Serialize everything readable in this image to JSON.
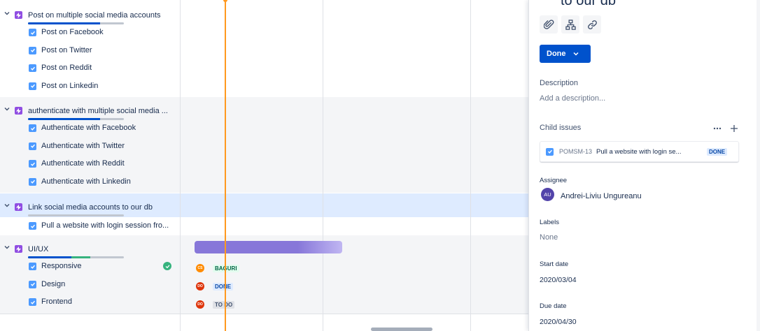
{
  "epics": [
    {
      "title": "Post on multiple social media accounts",
      "progress_done_pct": 75,
      "progress_inprogress_pct": 0,
      "children": [
        "Post on Facebook",
        "Post on Twitter",
        "Post on Reddit",
        "Post on Linkedin"
      ]
    },
    {
      "title": "authenticate with multiple social media ...",
      "progress_done_pct": 75,
      "progress_inprogress_pct": 0,
      "children": [
        "Authenticate with Facebook",
        "Authenticate with Twitter",
        "Authenticate with Reddit",
        "Authenticate with Linkedin"
      ]
    },
    {
      "title": "Link social media accounts to our db",
      "progress_done_pct": 0,
      "progress_inprogress_pct": 0,
      "children": [
        "Pull a website with login session fro..."
      ]
    },
    {
      "title": "UI/UX",
      "progress_done_pct": 45,
      "progress_inprogress_pct": 20,
      "children": [
        "Responsive",
        "Design",
        "Frontend"
      ]
    }
  ],
  "timeline": {
    "statuses": [
      {
        "initials": "CS",
        "label": "BAGURI",
        "avatar_color": "#ff8b00",
        "text_color": "#006644",
        "bg_color": "#e3fcef"
      },
      {
        "initials": "DO",
        "label": "DONE",
        "avatar_color": "#de350b",
        "text_color": "#0747a6",
        "bg_color": "#deebff"
      },
      {
        "initials": "DO",
        "label": "TO DO",
        "avatar_color": "#de350b",
        "text_color": "#42526e",
        "bg_color": "#dfe1e6"
      }
    ]
  },
  "panel": {
    "title": "to our db",
    "status_button": "Done",
    "description_label": "Description",
    "description_placeholder": "Add a description...",
    "child_issues_label": "Child issues",
    "child_issue": {
      "key": "POMSM-13",
      "summary": "Pull a website with login se...",
      "status": "DONE"
    },
    "assignee_label": "Assignee",
    "assignee_initials": "AU",
    "assignee_name": "Andrei-Liviu Ungureanu",
    "labels_label": "Labels",
    "labels_value": "None",
    "start_date_label": "Start date",
    "start_date": "2020/03/04",
    "due_date_label": "Due date",
    "due_date": "2020/04/30"
  },
  "colors": {
    "accent": "#0052cc",
    "epic": "#904ee2",
    "today_line": "#ff991f",
    "roadmap_bar": "#8777d9"
  }
}
